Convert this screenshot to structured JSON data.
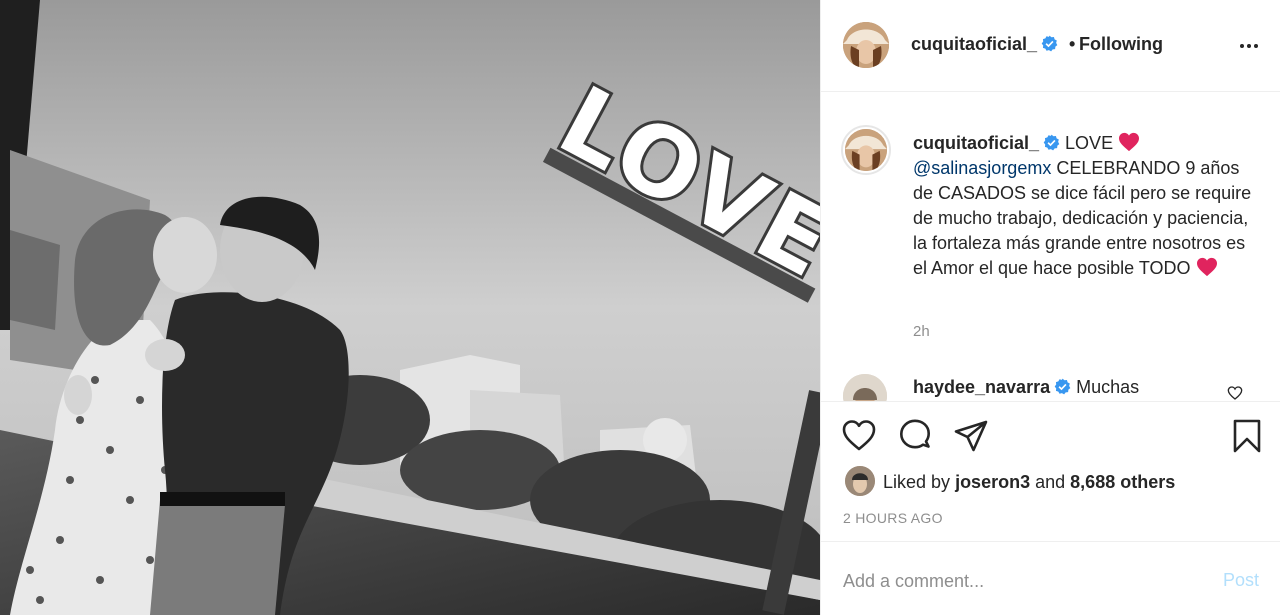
{
  "post": {
    "author": "cuquitaoficial_",
    "follow_separator": "•",
    "follow_status": "Following",
    "caption": {
      "author": "cuquitaoficial_",
      "text_1": "LOVE",
      "mention": "@salinasjorgemx",
      "text_2": "CELEBRANDO 9 años de CASADOS se dice fácil pero se require de mucho trabajo, dedicación y paciencia, la fortaleza más grande entre nosotros es el Amor el que hace posible TODO",
      "time_ago": "2h"
    },
    "comments": [
      {
        "author": "haydee_navarra",
        "text": "Muchas"
      }
    ],
    "likes": {
      "prefix": "Liked by",
      "user": "joseron3",
      "middle": "and",
      "others": "8,688 others"
    },
    "timestamp": "2 HOURS AGO",
    "photo_sign_text": "LOVE",
    "add_comment": {
      "placeholder": "Add a comment...",
      "post_label": "Post"
    },
    "colors": {
      "verified": "#3897f0",
      "heart": "#e0245e",
      "mention": "#00376b",
      "post_disabled": "#b2dffc",
      "muted": "#8e8e8e"
    },
    "icons": [
      "more-icon",
      "verified-icon",
      "heart-icon",
      "comment-icon",
      "share-icon",
      "save-icon"
    ]
  }
}
